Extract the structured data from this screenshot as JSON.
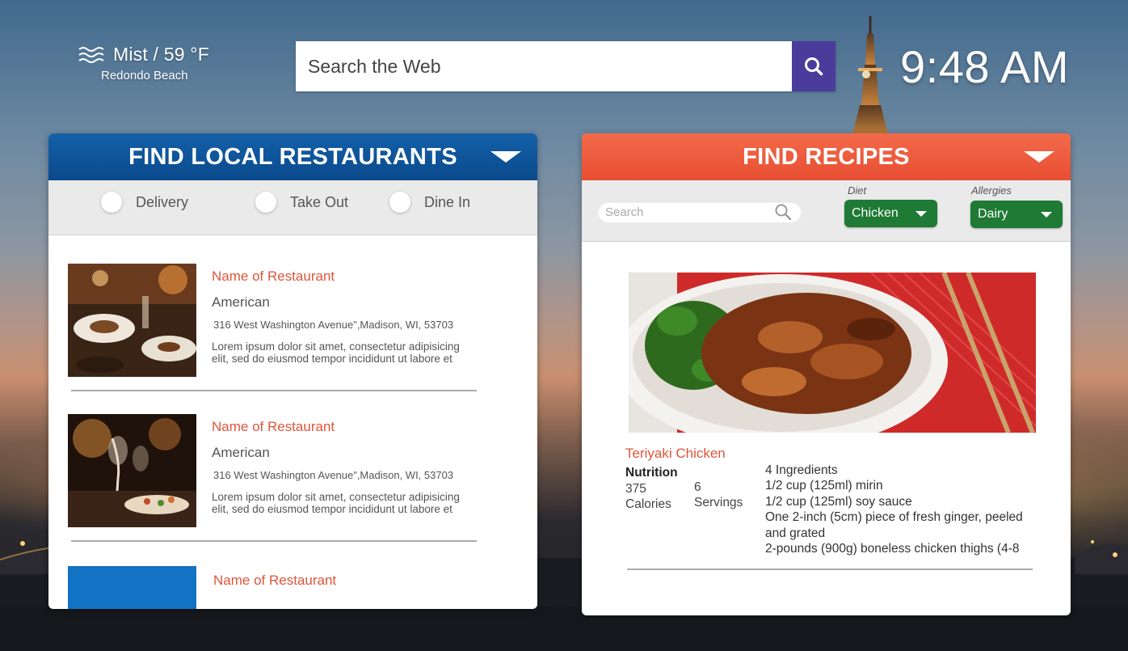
{
  "weather": {
    "condition": "Mist / 59 °F",
    "location": "Redondo Beach",
    "icon": "mist-icon"
  },
  "web_search": {
    "placeholder": "Search the Web",
    "button_icon": "search-icon",
    "button_color": "#4b3c9b"
  },
  "clock": {
    "time": "9:48 AM"
  },
  "restaurants_panel": {
    "title": "FIND LOCAL RESTAURANTS",
    "header_color": "#0f56a0",
    "filters": [
      {
        "label": "Delivery"
      },
      {
        "label": "Take Out"
      },
      {
        "label": "Dine In"
      }
    ],
    "items": [
      {
        "name": "Name of Restaurant",
        "cuisine": "American",
        "address": "316 West Washington Avenue\",Madison, WI, 53703",
        "description": "Lorem ipsum dolor sit amet, consectetur adipisicing elit, sed do eiusmod tempor incididunt ut labore et"
      },
      {
        "name": "Name of Restaurant",
        "cuisine": "American",
        "address": "316 West Washington Avenue\",Madison, WI, 53703",
        "description": "Lorem ipsum dolor sit amet, consectetur adipisicing elit, sed do eiusmod tempor incididunt ut labore et"
      },
      {
        "name": "Name of Restaurant"
      }
    ]
  },
  "recipes_panel": {
    "title": "FIND RECIPES",
    "header_color": "#ea5436",
    "search_placeholder": "Search",
    "diet": {
      "label": "Diet",
      "value": "Chicken"
    },
    "allergies": {
      "label": "Allergies",
      "value": "Dairy"
    },
    "dropdown_color": "#1e7a34",
    "recipe": {
      "title": "Teriyaki Chicken",
      "nutrition_label": "Nutrition",
      "calories_value": "375",
      "calories_label": "Calories",
      "servings_value": "6",
      "servings_label": "Servings",
      "ingredients": [
        "4 Ingredients",
        "1/2 cup (125ml) mirin",
        "1/2 cup (125ml) soy sauce",
        "One 2-inch (5cm) piece of fresh ginger, peeled and grated",
        "2-pounds (900g) boneless chicken thighs (4-8"
      ]
    }
  }
}
